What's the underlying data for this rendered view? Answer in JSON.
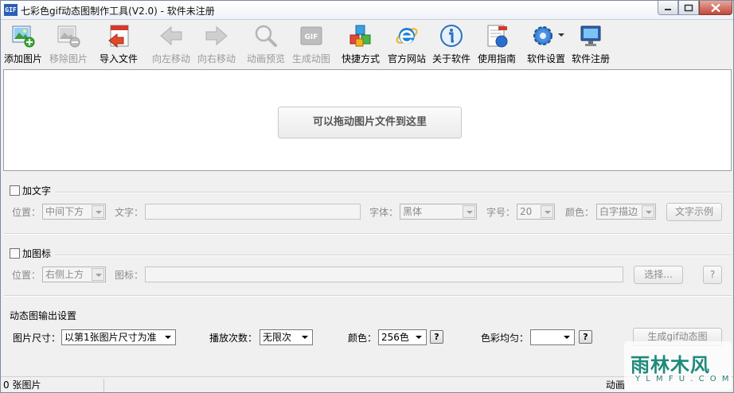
{
  "window": {
    "app_icon_text": "GIF",
    "title": "七彩色gif动态图制作工具(V2.0) - 软件未注册"
  },
  "toolbar": {
    "items": [
      {
        "label": "添加图片",
        "icon": "add-image-icon",
        "enabled": true
      },
      {
        "label": "移除图片",
        "icon": "remove-image-icon",
        "enabled": false
      },
      {
        "label": "导入文件",
        "icon": "import-file-icon",
        "enabled": true
      },
      {
        "label": "向左移动",
        "icon": "arrow-left-icon",
        "enabled": false
      },
      {
        "label": "向右移动",
        "icon": "arrow-right-icon",
        "enabled": false
      },
      {
        "label": "动画预览",
        "icon": "magnifier-icon",
        "enabled": false
      },
      {
        "label": "生成动图",
        "icon": "gif-generate-icon",
        "enabled": false
      },
      {
        "label": "快捷方式",
        "icon": "cubes-icon",
        "enabled": true
      },
      {
        "label": "官方网站",
        "icon": "ie-icon",
        "enabled": true
      },
      {
        "label": "关于软件",
        "icon": "info-icon",
        "enabled": true
      },
      {
        "label": "使用指南",
        "icon": "guide-icon",
        "enabled": true
      },
      {
        "label": "软件设置",
        "icon": "gear-icon",
        "enabled": true
      },
      {
        "label": "软件注册",
        "icon": "monitor-icon",
        "enabled": true
      }
    ],
    "gif_badge": "GIF"
  },
  "dropzone": {
    "hint": "可以拖动图片文件到这里"
  },
  "text_section": {
    "title": "加文字",
    "position_label": "位置：",
    "position_value": "中间下方",
    "text_label": "文字：",
    "font_label": "字体：",
    "font_value": "黑体",
    "size_label": "字号：",
    "size_value": "20",
    "color_label": "颜色：",
    "color_value": "白字描边",
    "example_button": "文字示例"
  },
  "icon_section": {
    "title": "加图标",
    "position_label": "位置：",
    "position_value": "右侧上方",
    "icon_label": "图标：",
    "select_button": "选择...",
    "help_button": "?"
  },
  "output_section": {
    "title": "动态图输出设置",
    "size_label": "图片尺寸：",
    "size_value": "以第1张图片尺寸为准",
    "loop_label": "播放次数：",
    "loop_value": "无限次",
    "color_label": "颜色：",
    "color_value": "256色",
    "color_help": "?",
    "balance_label": "色彩均匀：",
    "balance_value": "",
    "balance_help": "?",
    "generate_button": "生成gif动态图"
  },
  "statusbar": {
    "count": "0 张图片",
    "right": "动画"
  },
  "watermark": {
    "main": "雨林木风",
    "sub": "Y L M F U . C O M"
  },
  "colors": {
    "close_button": "#c0493a",
    "watermark": "#1f8a7a"
  }
}
